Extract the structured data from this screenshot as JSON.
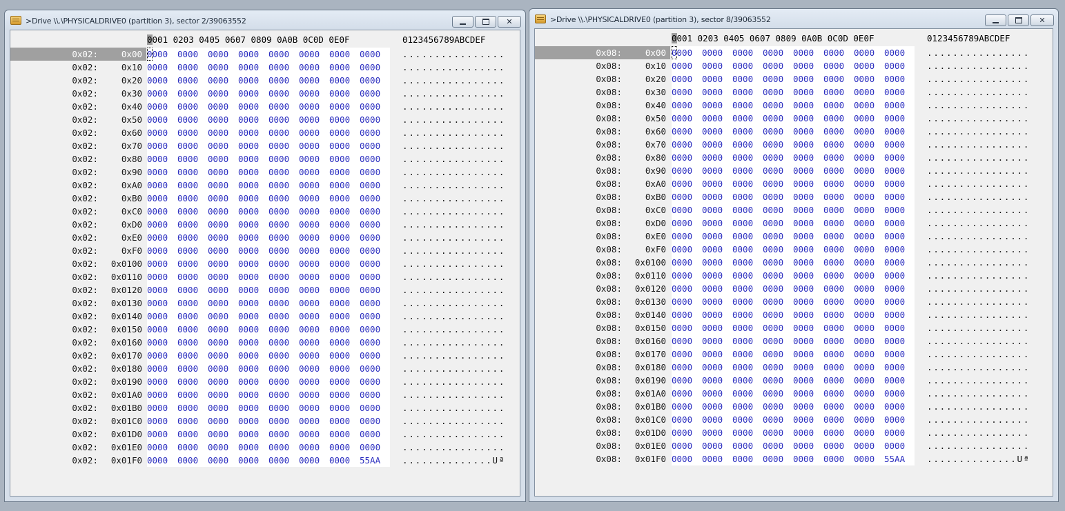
{
  "windows": [
    {
      "title": ">Drive \\\\.\\PHYSICALDRIVE0 (partition 3), sector 2/39063552",
      "sector_prefix": "0x02:",
      "header_hex": "0001 0203 0405 0607 0809 0A0B 0C0D 0E0F",
      "header_ascii": "0123456789ABCDEF"
    },
    {
      "title": ">Drive \\\\.\\PHYSICALDRIVE0 (partition 3), sector 8/39063552",
      "sector_prefix": "0x08:",
      "header_hex": "0001 0203 0405 0607 0809 0A0B 0C0D 0E0F",
      "header_ascii": "0123456789ABCDEF"
    }
  ],
  "offsets": [
    "0x00",
    "0x10",
    "0x20",
    "0x30",
    "0x40",
    "0x50",
    "0x60",
    "0x70",
    "0x80",
    "0x90",
    "0xA0",
    "0xB0",
    "0xC0",
    "0xD0",
    "0xE0",
    "0xF0",
    "0x0100",
    "0x0110",
    "0x0120",
    "0x0130",
    "0x0140",
    "0x0150",
    "0x0160",
    "0x0170",
    "0x0180",
    "0x0190",
    "0x01A0",
    "0x01B0",
    "0x01C0",
    "0x01D0",
    "0x01E0",
    "0x01F0"
  ],
  "zero_word": "0000",
  "zero_ascii": "................",
  "last_row_last_word": "55AA",
  "last_row_ascii": "..............Uª",
  "selected_row": 0,
  "colors": {
    "hex_text": "#2b2ec0",
    "selection": "#a0a0a0"
  }
}
